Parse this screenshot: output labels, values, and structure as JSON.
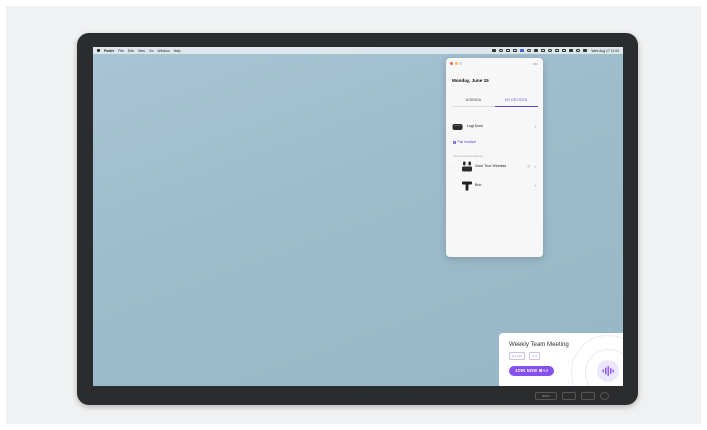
{
  "menubar": {
    "items": [
      "Finder",
      "File",
      "Edit",
      "View",
      "Go",
      "Window",
      "Help"
    ],
    "clock": "Wed Aug 17  11:03"
  },
  "popover": {
    "more": "•••",
    "date": "Monday, June 15",
    "tabs": {
      "agenda": "AGENDA",
      "devices": "MY DEVICES"
    },
    "devices": [
      {
        "name": "Logi Dock"
      },
      {
        "name": "Zone True Wireless"
      },
      {
        "name": "Brio"
      }
    ],
    "pair_label": "Pair headset",
    "section_label": "Recommended settings",
    "chevron": "›"
  },
  "meeting": {
    "title": "Weekly Team Meeting",
    "duration": "in 1 min",
    "attendees": "4",
    "join_label": "JOIN NOW ⌘+J"
  },
  "monitor_buttons": [
    "MENU",
    "",
    "",
    ""
  ],
  "colors": {
    "accent": "#5b43d6",
    "join": "#8650ef",
    "desktop": "#a9c4d4",
    "bezel": "#2b2c2e"
  }
}
